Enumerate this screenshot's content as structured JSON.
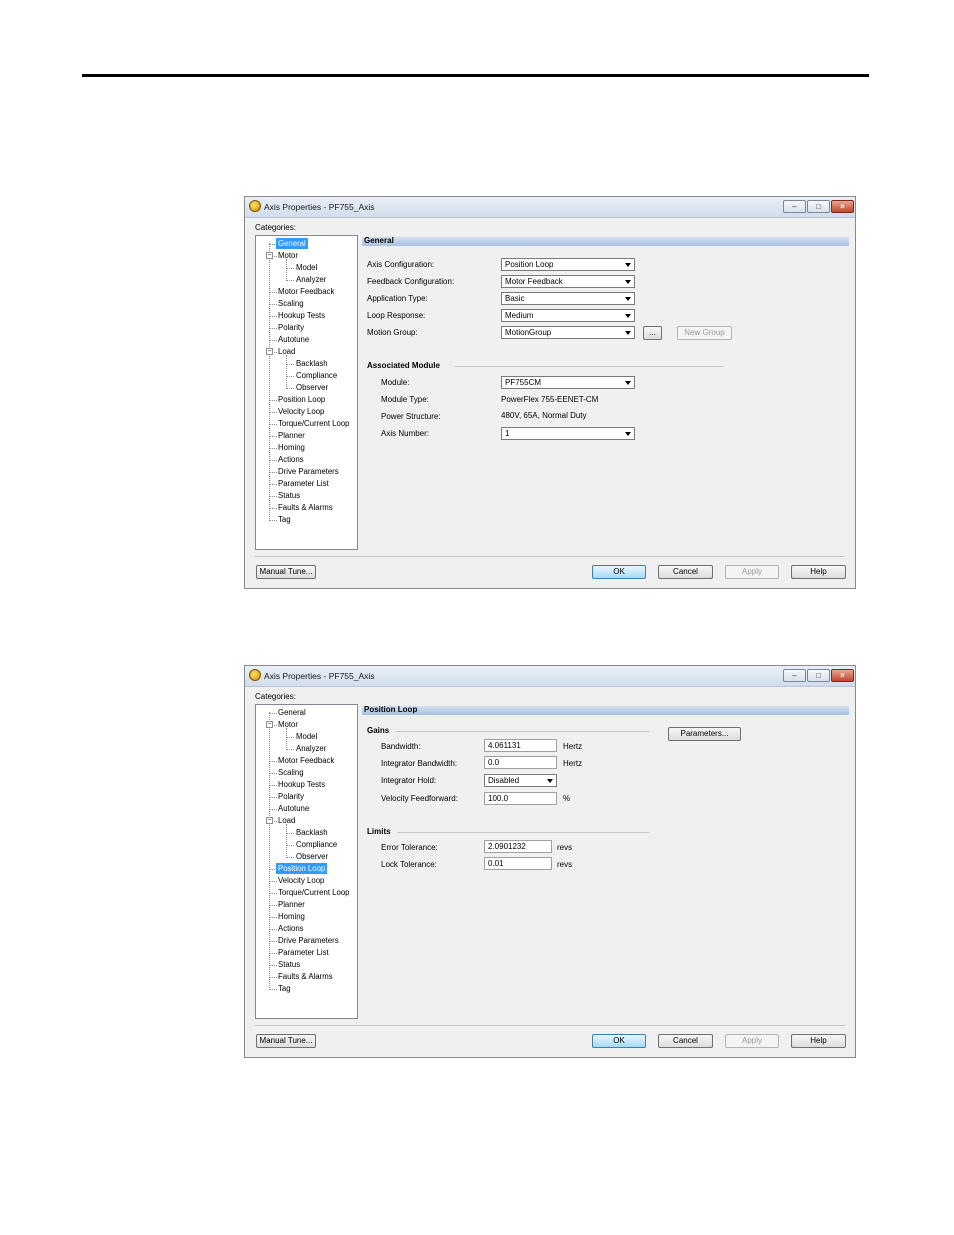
{
  "dialog_general": {
    "title": "Axis Properties - PF755_Axis",
    "categories_label": "Categories:",
    "section_title": "General",
    "fields": {
      "axis_configuration": {
        "label": "Axis Configuration:",
        "value": "Position Loop"
      },
      "feedback_configuration": {
        "label": "Feedback Configuration:",
        "value": "Motor Feedback"
      },
      "application_type": {
        "label": "Application Type:",
        "value": "Basic"
      },
      "loop_response": {
        "label": "Loop Response:",
        "value": "Medium"
      },
      "motion_group": {
        "label": "Motion Group:",
        "value": "MotionGroup"
      }
    },
    "browse_button": "...",
    "new_group_button": "New Group",
    "associated_module": {
      "heading": "Associated Module",
      "module": {
        "label": "Module:",
        "value": "PF755CM"
      },
      "module_type": {
        "label": "Module Type:",
        "value": "PowerFlex 755-EENET-CM"
      },
      "power_structure": {
        "label": "Power Structure:",
        "value": "480V, 65A, Normal Duty"
      },
      "axis_number": {
        "label": "Axis Number:",
        "value": "1"
      }
    },
    "selected_category": "General"
  },
  "dialog_position": {
    "title": "Axis Properties - PF755_Axis",
    "categories_label": "Categories:",
    "section_title": "Position Loop",
    "parameters_button": "Parameters...",
    "gains": {
      "heading": "Gains",
      "bandwidth": {
        "label": "Bandwidth:",
        "value": "4.061131",
        "unit": "Hertz"
      },
      "integrator_bandwidth": {
        "label": "Integrator Bandwidth:",
        "value": "0.0",
        "unit": "Hertz"
      },
      "integrator_hold": {
        "label": "Integrator Hold:",
        "value": "Disabled"
      },
      "velocity_feedforward": {
        "label": "Velocity Feedforward:",
        "value": "100.0",
        "unit": "%"
      }
    },
    "limits": {
      "heading": "Limits",
      "error_tolerance": {
        "label": "Error Tolerance:",
        "value": "2.0901232",
        "unit": "revs"
      },
      "lock_tolerance": {
        "label": "Lock Tolerance:",
        "value": "0.01",
        "unit": "revs"
      }
    },
    "selected_category": "Position Loop"
  },
  "tree": [
    {
      "label": "General"
    },
    {
      "label": "Motor"
    },
    {
      "label": "Model"
    },
    {
      "label": "Analyzer"
    },
    {
      "label": "Motor Feedback"
    },
    {
      "label": "Scaling"
    },
    {
      "label": "Hookup Tests"
    },
    {
      "label": "Polarity"
    },
    {
      "label": "Autotune"
    },
    {
      "label": "Load"
    },
    {
      "label": "Backlash"
    },
    {
      "label": "Compliance"
    },
    {
      "label": "Observer"
    },
    {
      "label": "Position Loop"
    },
    {
      "label": "Velocity Loop"
    },
    {
      "label": "Torque/Current Loop"
    },
    {
      "label": "Planner"
    },
    {
      "label": "Homing"
    },
    {
      "label": "Actions"
    },
    {
      "label": "Drive Parameters"
    },
    {
      "label": "Parameter List"
    },
    {
      "label": "Status"
    },
    {
      "label": "Faults & Alarms"
    },
    {
      "label": "Tag"
    }
  ],
  "buttons": {
    "manual_tune": "Manual Tune...",
    "ok": "OK",
    "cancel": "Cancel",
    "apply": "Apply",
    "help": "Help"
  },
  "window_controls": {
    "minimize": "–",
    "maximize": "□",
    "close": "×"
  }
}
